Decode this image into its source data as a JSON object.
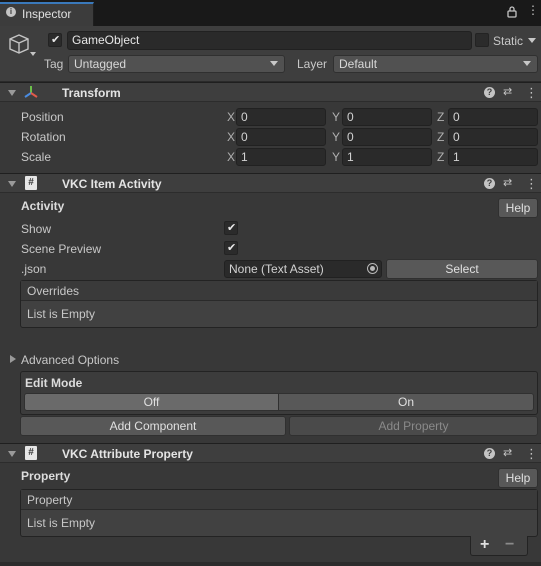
{
  "tab": {
    "title": "Inspector"
  },
  "header": {
    "name": "GameObject",
    "static_label": "Static",
    "tag_label": "Tag",
    "tag_value": "Untagged",
    "layer_label": "Layer",
    "layer_value": "Default"
  },
  "transform": {
    "title": "Transform",
    "rows": [
      {
        "label": "Position",
        "x": "0",
        "y": "0",
        "z": "0"
      },
      {
        "label": "Rotation",
        "x": "0",
        "y": "0",
        "z": "0"
      },
      {
        "label": "Scale",
        "x": "1",
        "y": "1",
        "z": "1"
      }
    ],
    "axes": {
      "x": "X",
      "y": "Y",
      "z": "Z"
    }
  },
  "vkc_item": {
    "title": "VKC Item Activity",
    "section": "Activity",
    "help": "Help",
    "show_label": "Show",
    "scene_preview_label": "Scene Preview",
    "json_label": ".json",
    "json_value": "None (Text Asset)",
    "select_label": "Select",
    "overrides_label": "Overrides",
    "overrides_empty": "List is Empty",
    "advanced_label": "Advanced Options",
    "edit_mode_label": "Edit Mode",
    "off_label": "Off",
    "on_label": "On",
    "add_component": "Add Component",
    "add_property": "Add Property"
  },
  "vkc_attr": {
    "title": "VKC Attribute Property",
    "section": "Property",
    "help": "Help",
    "list_header": "Property",
    "list_empty": "List is Empty",
    "plus": "+",
    "minus": "−"
  }
}
